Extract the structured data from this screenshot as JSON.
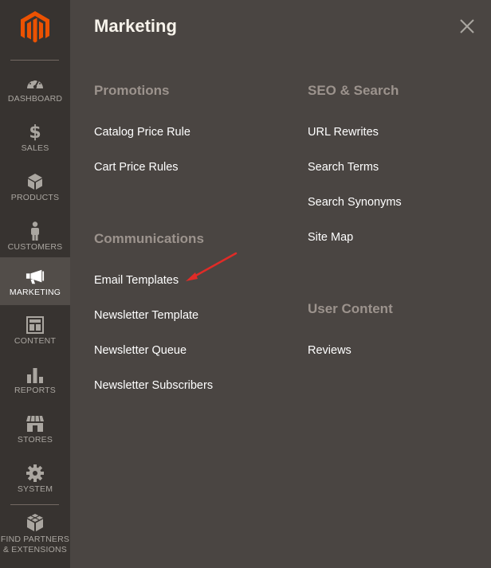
{
  "sidebar": {
    "logo_icon": "magento-logo-icon",
    "items": [
      {
        "label": "Dashboard",
        "icon": "dashboard-icon",
        "active": false
      },
      {
        "label": "Sales",
        "icon": "dollar-icon",
        "active": false
      },
      {
        "label": "Products",
        "icon": "cube-icon",
        "active": false
      },
      {
        "label": "Customers",
        "icon": "person-icon",
        "active": false
      },
      {
        "label": "Marketing",
        "icon": "megaphone-icon",
        "active": true
      },
      {
        "label": "Content",
        "icon": "layout-icon",
        "active": false
      },
      {
        "label": "Reports",
        "icon": "bar-chart-icon",
        "active": false
      },
      {
        "label": "Stores",
        "icon": "storefront-icon",
        "active": false
      },
      {
        "label": "System",
        "icon": "gear-icon",
        "active": false
      }
    ],
    "partners_line1": "Find Partners",
    "partners_line2": "& Extensions"
  },
  "panel": {
    "title": "Marketing",
    "close_icon": "close-icon",
    "sections": {
      "promotions": {
        "title": "Promotions",
        "links": [
          "Catalog Price Rule",
          "Cart Price Rules"
        ]
      },
      "communications": {
        "title": "Communications",
        "links": [
          "Email Templates",
          "Newsletter Template",
          "Newsletter Queue",
          "Newsletter Subscribers"
        ]
      },
      "seo": {
        "title": "SEO & Search",
        "links": [
          "URL Rewrites",
          "Search Terms",
          "Search Synonyms",
          "Site Map"
        ]
      },
      "user_content": {
        "title": "User Content",
        "links": [
          "Reviews"
        ]
      }
    },
    "annotation_icon": "red-arrow-icon"
  },
  "colors": {
    "sidebar_bg": "#373330",
    "panel_bg": "#4a4542",
    "active_bg": "#524d49",
    "brand_orange": "#eb5202",
    "arrow_red": "#e02b27"
  }
}
